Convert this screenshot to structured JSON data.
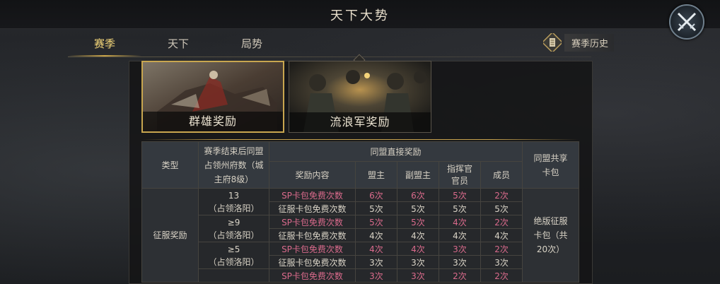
{
  "title": "天下大势",
  "tabs": [
    {
      "label": "赛季",
      "active": true
    },
    {
      "label": "天下",
      "active": false
    },
    {
      "label": "局势",
      "active": false
    }
  ],
  "history_button": {
    "label": "赛季历史"
  },
  "cards": [
    {
      "label": "群雄奖励",
      "active": true
    },
    {
      "label": "流浪军奖励",
      "active": false
    }
  ],
  "table": {
    "headers": {
      "type": "类型",
      "condition": "赛季结束后同盟占领州府数（城主府8级）",
      "direct_group": "同盟直接奖励",
      "content": "奖励内容",
      "leader": "盟主",
      "vice": "副盟主",
      "officer": "指挥官官员",
      "member": "成员",
      "shared": "同盟共享卡包"
    },
    "type_label": "征服奖励",
    "shared_label": "绝版征服卡包（共20次）",
    "groups": [
      {
        "condition_line1": "13",
        "condition_line2": "（占领洛阳）",
        "rows": [
          {
            "content": "SP卡包免费次数",
            "leader": "6次",
            "vice": "6次",
            "officer": "5次",
            "member": "2次",
            "highlight": true
          },
          {
            "content": "征服卡包免费次数",
            "leader": "5次",
            "vice": "5次",
            "officer": "5次",
            "member": "5次",
            "highlight": false
          }
        ]
      },
      {
        "condition_line1": "≥9",
        "condition_line2": "（占领洛阳）",
        "rows": [
          {
            "content": "SP卡包免费次数",
            "leader": "5次",
            "vice": "5次",
            "officer": "4次",
            "member": "2次",
            "highlight": true
          },
          {
            "content": "征服卡包免费次数",
            "leader": "4次",
            "vice": "4次",
            "officer": "4次",
            "member": "4次",
            "highlight": false
          }
        ]
      },
      {
        "condition_line1": "≥5",
        "condition_line2": "（占领洛阳）",
        "rows": [
          {
            "content": "SP卡包免费次数",
            "leader": "4次",
            "vice": "4次",
            "officer": "3次",
            "member": "2次",
            "highlight": true
          },
          {
            "content": "征服卡包免费次数",
            "leader": "3次",
            "vice": "3次",
            "officer": "3次",
            "member": "3次",
            "highlight": false
          }
        ]
      },
      {
        "condition_line1": "",
        "condition_line2": "",
        "rows": [
          {
            "content": "SP卡包免费次数",
            "leader": "3次",
            "vice": "3次",
            "officer": "2次",
            "member": "2次",
            "highlight": true
          }
        ]
      }
    ]
  },
  "colors": {
    "accent_gold": "#c8a64f",
    "highlight_pink": "#d96a8b",
    "tab_active": "#f3d679"
  },
  "icons": {
    "close": "crossed-swords-icon",
    "history": "scroll-icon"
  }
}
